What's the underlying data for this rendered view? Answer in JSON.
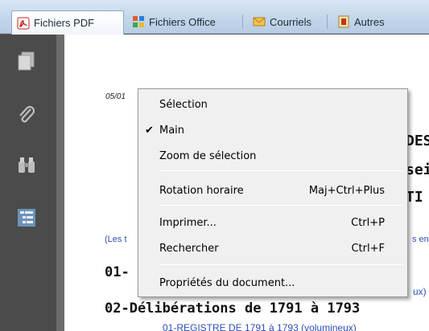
{
  "tabs": [
    {
      "label": "Fichiers PDF",
      "icon": "pdf-icon",
      "active": true
    },
    {
      "label": "Fichiers Office",
      "icon": "office-icon",
      "active": false
    },
    {
      "label": "Courriels",
      "icon": "email-icon",
      "active": false
    },
    {
      "label": "Autres",
      "icon": "other-files-icon",
      "active": false
    }
  ],
  "sidebar": {
    "icons": [
      "pages-icon",
      "attachment-icon",
      "binoculars-icon",
      "bookmarks-icon"
    ]
  },
  "document": {
    "date": "05/01",
    "header_lines": [
      "DES",
      "sei",
      "TI"
    ],
    "note_left": "(Les t",
    "note_right": "s en",
    "section_01": "01-",
    "note_ux": "ux)",
    "section_02": "02-Délibérations de 1791 à 1793",
    "link_01": "01-REGISTRE DE 1791 à 1793 (volumineux)"
  },
  "context_menu": {
    "items": [
      {
        "label": "Sélection",
        "shortcut": "",
        "checked": false
      },
      {
        "label": "Main",
        "shortcut": "",
        "checked": true
      },
      {
        "label": "Zoom de sélection",
        "shortcut": "",
        "checked": false
      },
      {
        "label": "Rotation horaire",
        "shortcut": "Maj+Ctrl+Plus",
        "checked": false
      },
      {
        "label": "Imprimer...",
        "shortcut": "Ctrl+P",
        "checked": false
      },
      {
        "label": "Rechercher",
        "shortcut": "Ctrl+F",
        "checked": false
      },
      {
        "label": "Propriétés du document...",
        "shortcut": "",
        "checked": false
      }
    ],
    "check_glyph": "✔"
  },
  "colors": {
    "tabbar": "#c3d6ea",
    "sidebar": "#4b4b4b",
    "link_blue": "#2d4fb5",
    "menu_bg": "#f0f0f0"
  }
}
